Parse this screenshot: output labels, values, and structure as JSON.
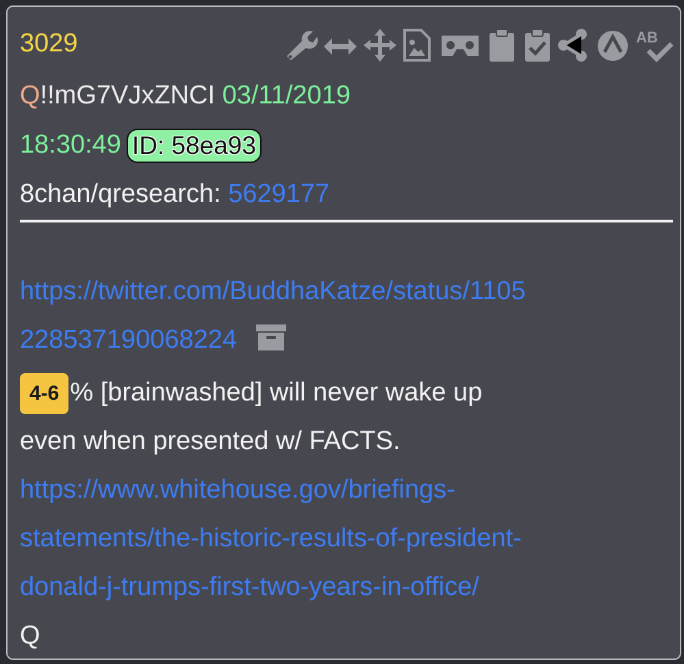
{
  "post": {
    "number": "3029",
    "author_name": "Q",
    "tripcode": "!!mG7VJxZNCI",
    "date": "03/11/2019",
    "time": "18:30:49",
    "id_label": "ID: 58ea93",
    "board": "8chan/qresearch:",
    "thread_link": "5629177"
  },
  "toolbar": {
    "icons": [
      "wrench-icon",
      "horizontal-arrows-icon",
      "move-icon",
      "image-file-icon",
      "vr-headset-icon",
      "clipboard-icon",
      "clipboard-check-icon",
      "share-icon",
      "triangle-circle-icon",
      "spellcheck-icon"
    ]
  },
  "content": {
    "link1_line1": "https://twitter.com/BuddhaKatze/status/1105",
    "link1_line2": "228537190068224",
    "badge": "4-6",
    "text_line1": "% [brainwashed] will never wake up",
    "text_line2": "even when presented w/ FACTS.",
    "link2_line1": "https://www.whitehouse.gov/briefings-",
    "link2_line2": "statements/the-historic-results-of-president-",
    "link2_line3": "donald-j-trumps-first-two-years-in-office/",
    "signature": "Q"
  },
  "colors": {
    "card_bg": "#47484f",
    "number": "#f5d547",
    "date": "#7df09a",
    "link": "#3d7cf2",
    "badge_bg": "#f5c441",
    "id_badge_bg": "#8df0a2",
    "icon": "#9a9ba1"
  }
}
